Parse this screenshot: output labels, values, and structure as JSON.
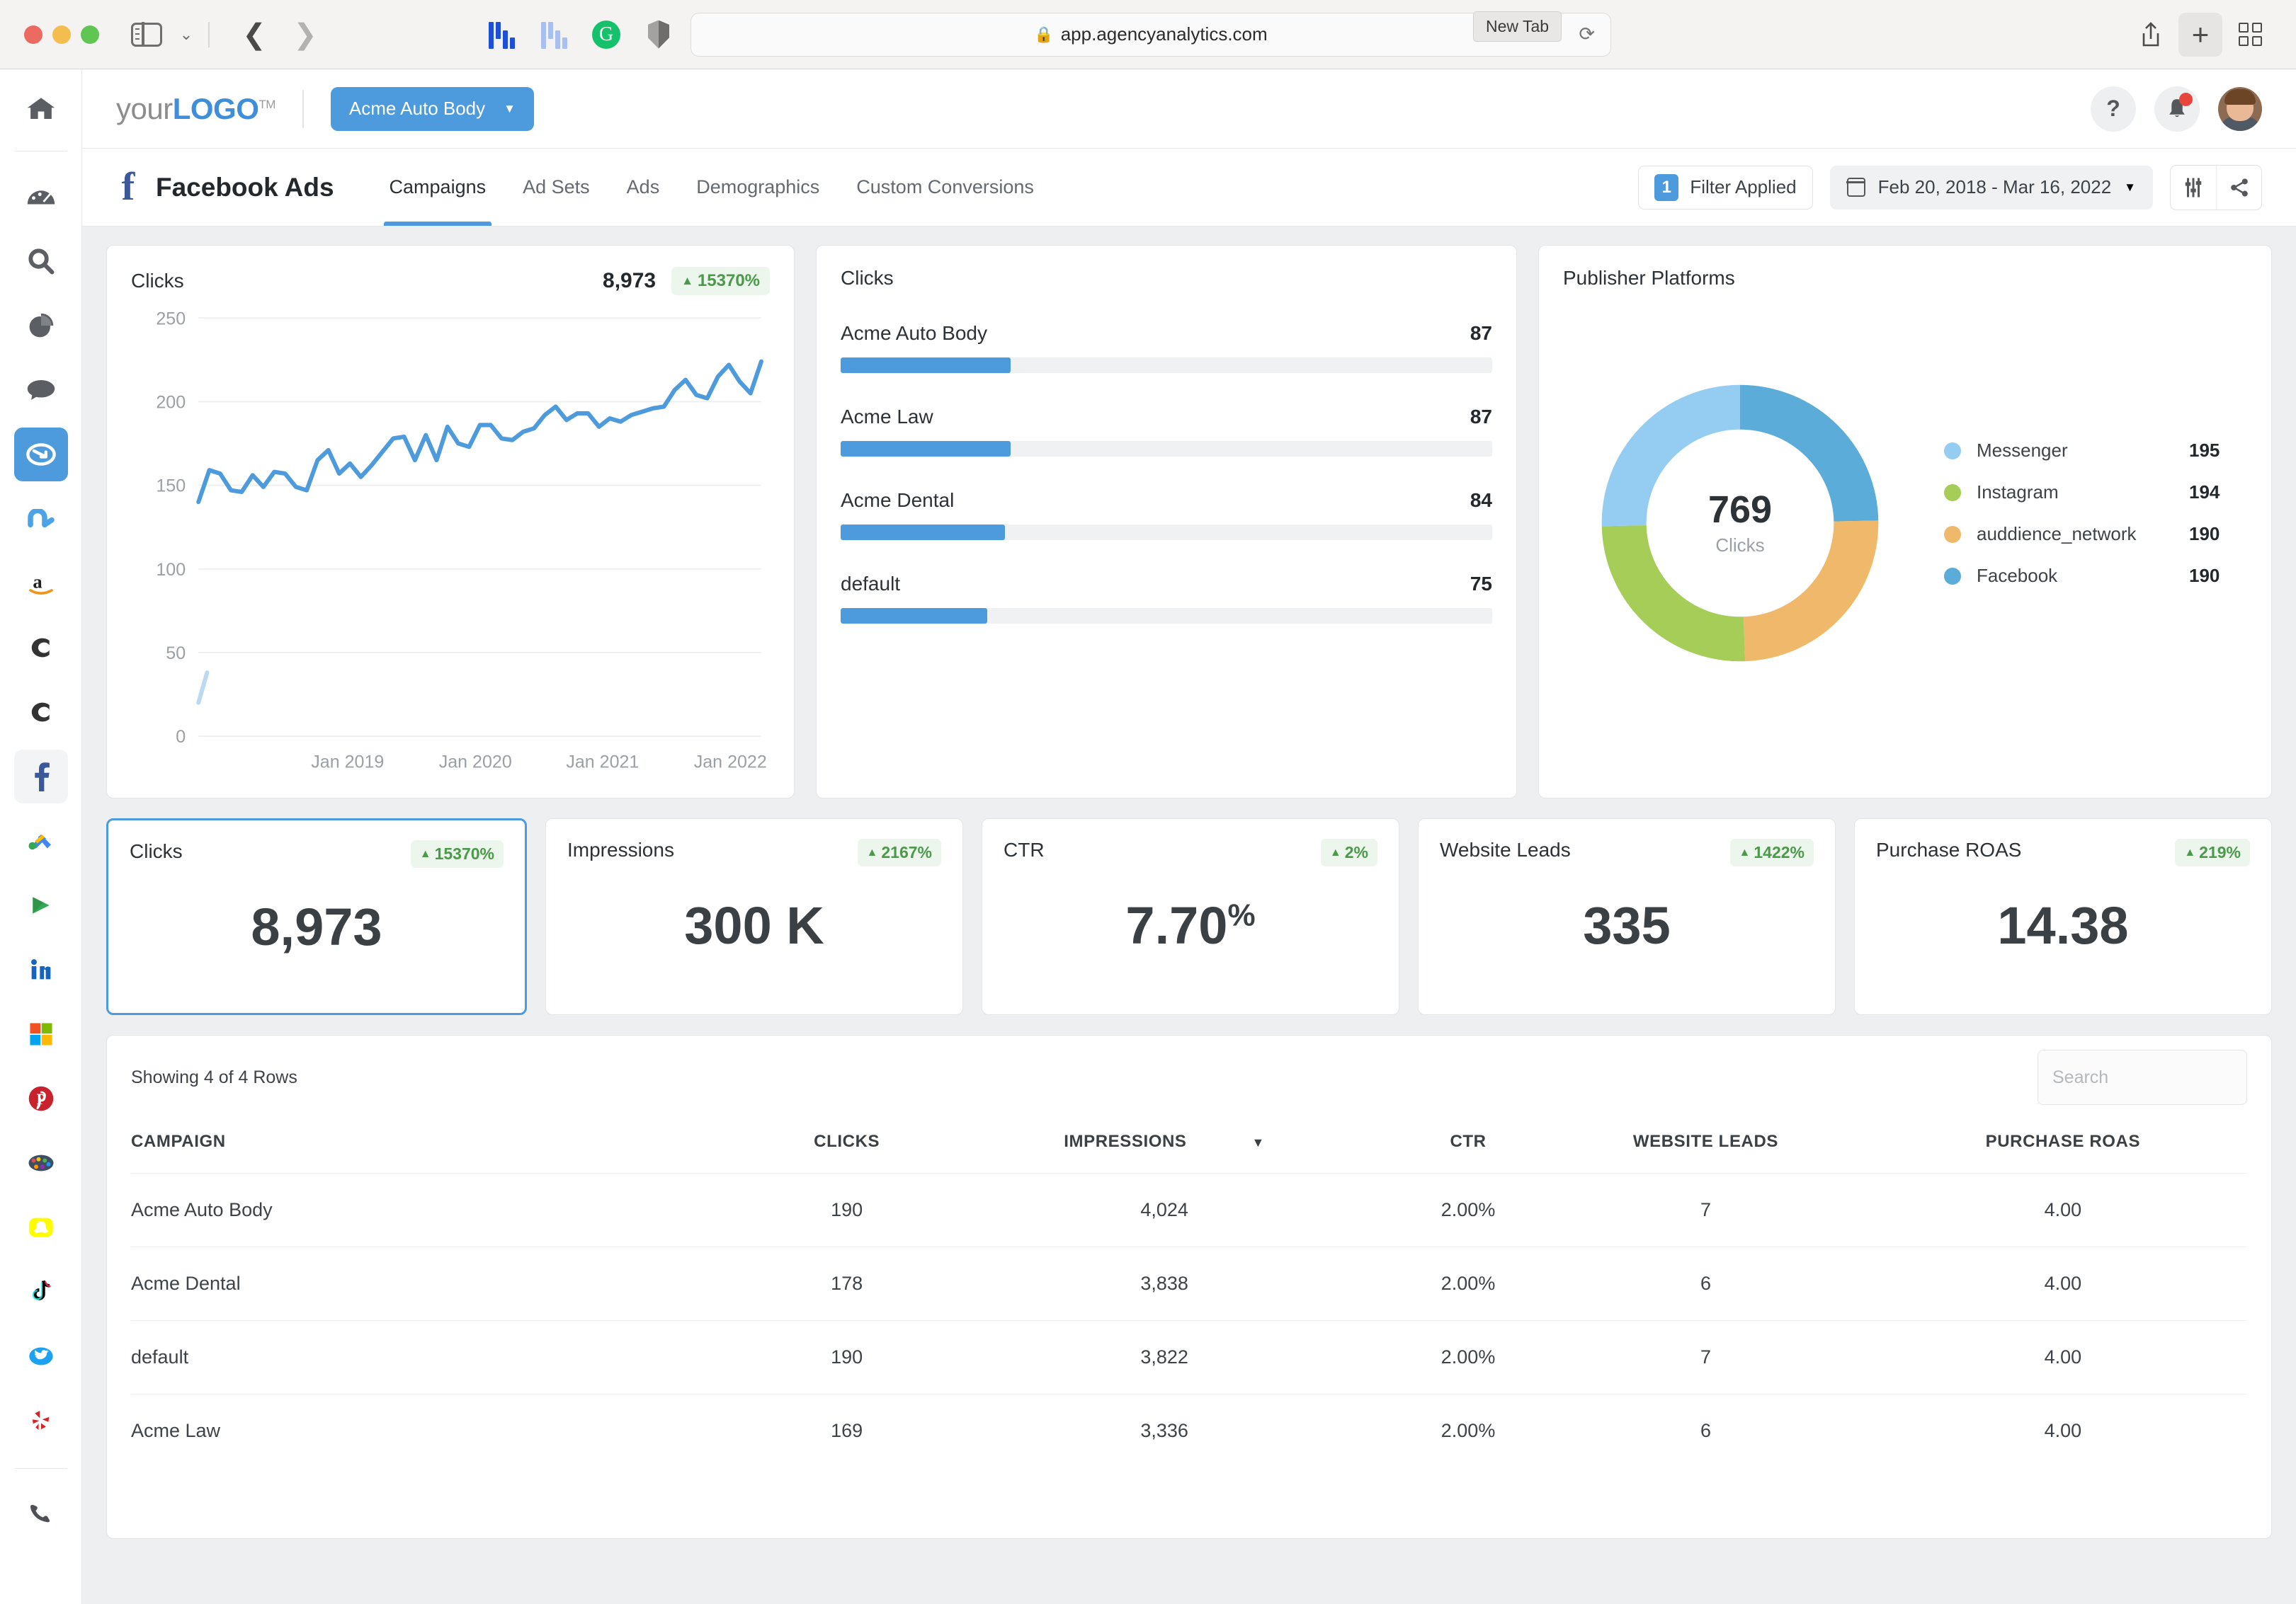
{
  "browser": {
    "url": "app.agencyanalytics.com",
    "lock_icon": "lock-icon",
    "tooltip": "New Tab",
    "reload_icon": "reload-icon",
    "extensions": [
      "honey-dark-icon",
      "honey-light-icon",
      "grammarly-icon",
      "shield-icon"
    ]
  },
  "topbar": {
    "logo_your": "your",
    "logo_bold": "LOGO",
    "logo_tm": "TM",
    "account": "Acme Auto Body",
    "help_label": "?",
    "icons": [
      "help-icon",
      "bell-icon",
      "avatar"
    ]
  },
  "subbar": {
    "page_title": "Facebook Ads",
    "tabs": [
      {
        "label": "Campaigns",
        "active": true
      },
      {
        "label": "Ad Sets",
        "active": false
      },
      {
        "label": "Ads",
        "active": false
      },
      {
        "label": "Demographics",
        "active": false
      },
      {
        "label": "Custom Conversions",
        "active": false
      }
    ],
    "filter_count": "1",
    "filter_label": "Filter Applied",
    "date_range": "Feb 20, 2018 - Mar 16, 2022"
  },
  "chart_data": [
    {
      "type": "line",
      "title": "Clicks",
      "total": "8,973",
      "change": "15370%",
      "change_direction": "up",
      "xlabel": "",
      "ylabel": "",
      "ylim": [
        0,
        250
      ],
      "yticks": [
        0,
        50,
        100,
        150,
        200,
        250
      ],
      "xtick_labels": [
        "Jan 2019",
        "Jan 2020",
        "Jan 2021",
        "Jan 2022"
      ],
      "grid": true,
      "series": [
        {
          "name": "Clicks",
          "color": "#4d9bdd",
          "values": [
            140,
            159,
            157,
            147,
            146,
            156,
            149,
            158,
            157,
            149,
            147,
            165,
            171,
            157,
            163,
            155,
            162,
            170,
            178,
            179,
            165,
            180,
            165,
            185,
            175,
            173,
            186,
            186,
            178,
            177,
            182,
            184,
            192,
            197,
            189,
            193,
            193,
            185,
            190,
            188,
            192,
            194,
            196,
            197,
            207,
            213,
            204,
            202,
            215,
            222,
            212,
            205,
            224
          ]
        },
        {
          "name": "Previous",
          "color": "#bcd9f2",
          "values": [
            20,
            38
          ]
        }
      ]
    },
    {
      "type": "bar",
      "title": "Clicks",
      "orientation": "horizontal",
      "categories": [
        "Acme Auto Body",
        "Acme Law",
        "Acme Dental",
        "default"
      ],
      "values": [
        87,
        87,
        84,
        75
      ],
      "max": 333,
      "color": "#4d9bdd"
    },
    {
      "type": "pie",
      "title": "Publisher Platforms",
      "center_value": "769",
      "center_label": "Clicks",
      "legend_position": "right",
      "labels": [
        "Messenger",
        "Instagram",
        "auddience_network",
        "Facebook"
      ],
      "values": [
        195,
        194,
        190,
        190
      ],
      "colors": [
        "#95cdf2",
        "#a5cd58",
        "#f0b86a",
        "#5bacd8"
      ]
    }
  ],
  "kpis": [
    {
      "label": "Clicks",
      "value": "8,973",
      "sup": "",
      "change": "15370%",
      "selected": true
    },
    {
      "label": "Impressions",
      "value": "300 K",
      "sup": "",
      "change": "2167%",
      "selected": false
    },
    {
      "label": "CTR",
      "value": "7.70",
      "sup": "%",
      "change": "2%",
      "selected": false
    },
    {
      "label": "Website Leads",
      "value": "335",
      "sup": "",
      "change": "1422%",
      "selected": false
    },
    {
      "label": "Purchase ROAS",
      "value": "14.38",
      "sup": "",
      "change": "219%",
      "selected": false
    }
  ],
  "table": {
    "showing": "Showing 4 of 4 Rows",
    "search_placeholder": "Search",
    "search_value": "",
    "sorted_column": "IMPRESSIONS",
    "columns": [
      "CAMPAIGN",
      "CLICKS",
      "IMPRESSIONS",
      "CTR",
      "WEBSITE LEADS",
      "PURCHASE ROAS"
    ],
    "rows": [
      {
        "campaign": "Acme Auto Body",
        "clicks": "190",
        "impressions": "4,024",
        "ctr": "2.00%",
        "leads": "7",
        "roas": "4.00"
      },
      {
        "campaign": "Acme Dental",
        "clicks": "178",
        "impressions": "3,838",
        "ctr": "2.00%",
        "leads": "6",
        "roas": "4.00"
      },
      {
        "campaign": "default",
        "clicks": "190",
        "impressions": "3,822",
        "ctr": "2.00%",
        "leads": "7",
        "roas": "4.00"
      },
      {
        "campaign": "Acme Law",
        "clicks": "169",
        "impressions": "3,336",
        "ctr": "2.00%",
        "leads": "6",
        "roas": "4.00"
      }
    ]
  },
  "sidebar": {
    "items": [
      {
        "name": "home-icon"
      },
      {
        "name": "dashboard-icon"
      },
      {
        "name": "search-icon"
      },
      {
        "name": "pie-chart-icon"
      },
      {
        "name": "chat-icon"
      },
      {
        "name": "ads-icon"
      },
      {
        "name": "adroll-icon"
      },
      {
        "name": "amazon-icon"
      },
      {
        "name": "callrail-icon"
      },
      {
        "name": "clickup-icon"
      },
      {
        "name": "facebook-icon"
      },
      {
        "name": "google-ads-icon"
      },
      {
        "name": "google-play-icon"
      },
      {
        "name": "linkedin-icon"
      },
      {
        "name": "microsoft-icon"
      },
      {
        "name": "pinterest-icon"
      },
      {
        "name": "palette-icon"
      },
      {
        "name": "snapchat-icon"
      },
      {
        "name": "tiktok-icon"
      },
      {
        "name": "twitter-icon"
      },
      {
        "name": "yelp-icon"
      },
      {
        "name": "phone-icon"
      }
    ]
  },
  "colors": {
    "accent": "#4d9bdd",
    "positive": "#4a9a49",
    "facebook": "#3b5998"
  }
}
